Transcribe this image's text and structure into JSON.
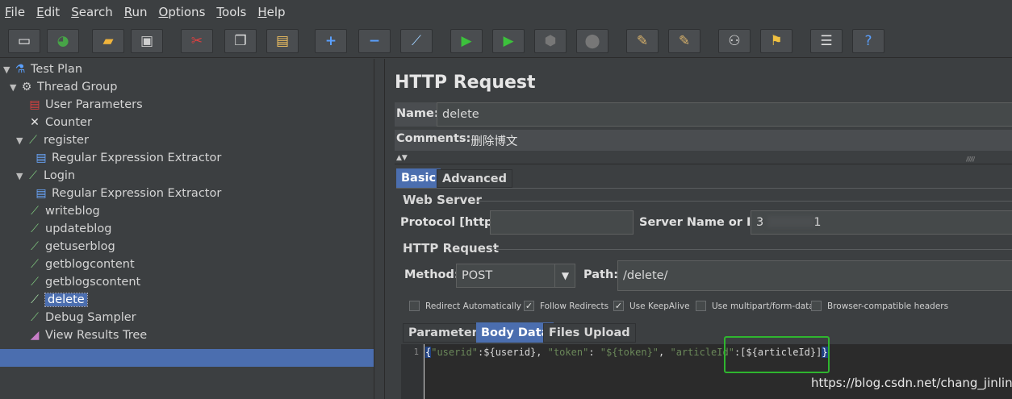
{
  "menu": [
    {
      "mn": "F",
      "rest": "ile"
    },
    {
      "mn": "E",
      "rest": "dit"
    },
    {
      "mn": "S",
      "rest": "earch"
    },
    {
      "mn": "R",
      "rest": "un"
    },
    {
      "mn": "O",
      "rest": "ptions"
    },
    {
      "mn": "T",
      "rest": "ools"
    },
    {
      "mn": "H",
      "rest": "elp"
    }
  ],
  "toolbar_icons": [
    "new-icon",
    "templates-icon",
    "open-icon",
    "save-icon",
    "cut-icon",
    "copy-icon",
    "paste-icon",
    "expand-icon",
    "collapse-icon",
    "toggle-icon",
    "start-icon",
    "start-no-timers-icon",
    "stop-icon",
    "shutdown-icon",
    "clear-icon",
    "clear-all-icon",
    "search-icon",
    "reset-search-icon",
    "function-helper-icon",
    "help-icon"
  ],
  "tree": {
    "test_plan": "Test Plan",
    "thread_group": "Thread Group",
    "user_parameters": "User Parameters",
    "counter": "Counter",
    "register": "register",
    "regex1": "Regular Expression Extractor",
    "login": "Login",
    "regex2": "Regular Expression Extractor",
    "writeblog": "writeblog",
    "updateblog": "updateblog",
    "getuserblog": "getuserblog",
    "getblogcontent": "getblogcontent",
    "getblogscontent": "getblogscontent",
    "delete": "delete",
    "debug_sampler": "Debug Sampler",
    "view_results_tree": "View Results Tree"
  },
  "panel": {
    "title": "HTTP Request",
    "name_label": "Name:",
    "name_value": "delete",
    "comments_label": "Comments:",
    "comments_value": "删除博文",
    "tab_basic": "Basic",
    "tab_advanced": "Advanced",
    "web_server_title": "Web Server",
    "protocol_label": "Protocol [http]:",
    "protocol_value": "",
    "server_label": "Server Name or IP:",
    "server_value_start": "3",
    "server_value_end": "1",
    "http_request_title": "HTTP Request",
    "method_label": "Method:",
    "method_value": "POST",
    "path_label": "Path:",
    "path_value": "/delete/",
    "checkboxes": {
      "redirect": {
        "label": "Redirect Automatically",
        "checked": false
      },
      "follow": {
        "label": "Follow Redirects",
        "checked": true
      },
      "keepalive": {
        "label": "Use KeepAlive",
        "checked": true
      },
      "multipart": {
        "label": "Use multipart/form-data",
        "checked": false
      },
      "browser": {
        "label": "Browser-compatible headers",
        "checked": false
      }
    },
    "tab_parameters": "Parameters",
    "tab_body_data": "Body Data",
    "tab_files_upload": "Files Upload",
    "line_number": "1",
    "code": {
      "open": "{",
      "k1": "\"userid\"",
      "v1": ":${userid}, ",
      "k2": "\"token\"",
      "sep2": ": ",
      "v2": "\"${token}\"",
      "comma2": ", ",
      "k3": "\"articleId\"",
      "v3": ":[${articleId}]",
      "close": "}"
    }
  },
  "watermark": "https://blog.csdn.net/chang_jinling",
  "colors": {
    "accent": "#4b6eaf",
    "background": "#3c3f41",
    "highlight_box": "#2fb52f"
  }
}
